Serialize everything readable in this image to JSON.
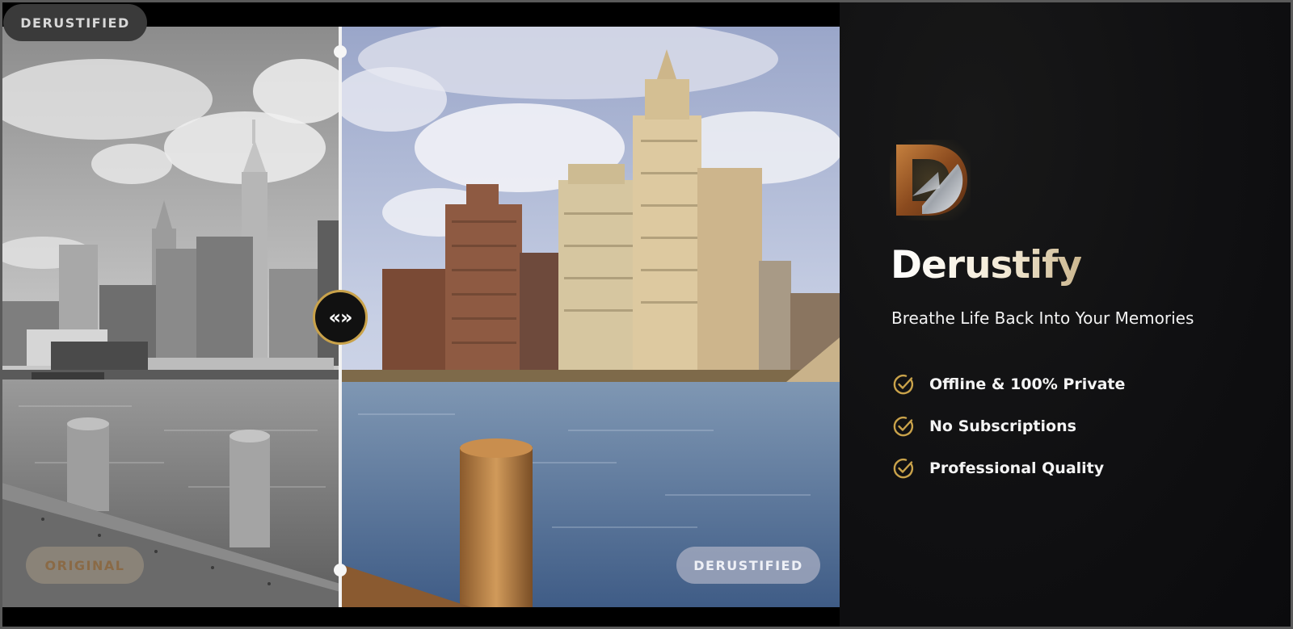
{
  "comparison": {
    "top_badge": "DERUSTIFIED",
    "before_label": "ORIGINAL",
    "after_label": "DERUSTIFIED",
    "handle_glyph": "«»",
    "divider_position_fraction": 0.4
  },
  "panel": {
    "app_name": "Derustify",
    "tagline": "Breathe Life Back Into Your Memories",
    "logo_icon": "rusted-letter-d-logo",
    "features": [
      {
        "icon": "check-circle-icon",
        "label": "Offline & 100% Private"
      },
      {
        "icon": "check-circle-icon",
        "label": "No Subscriptions"
      },
      {
        "icon": "check-circle-icon",
        "label": "Professional Quality"
      }
    ]
  },
  "colors": {
    "accent_gold": "#c9a24a",
    "panel_bg": "#101012",
    "frame_border": "#5a5a5a"
  }
}
